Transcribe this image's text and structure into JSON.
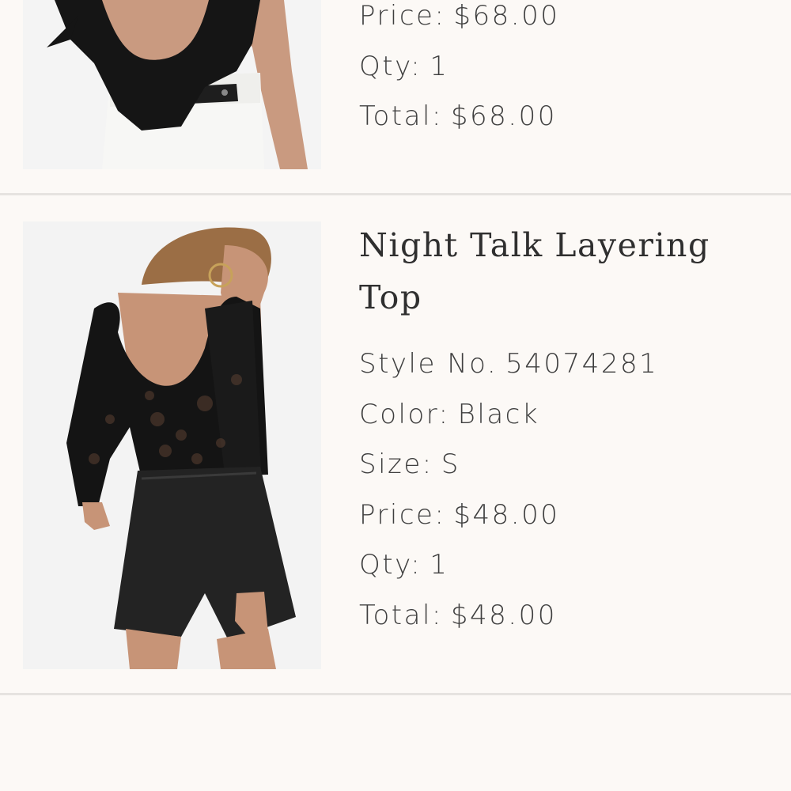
{
  "items": [
    {
      "price_label": "Price:",
      "price": "$68.00",
      "qty_label": "Qty:",
      "qty": "1",
      "total_label": "Total:",
      "total": "$68.00"
    },
    {
      "title_line1": "Night Talk Layering",
      "title_line2": "Top",
      "style_label": "Style No.",
      "style_no": "54074281",
      "color_label": "Color:",
      "color": "Black",
      "size_label": "Size:",
      "size": "S",
      "price_label": "Price:",
      "price": "$48.00",
      "qty_label": "Qty:",
      "qty": "1",
      "total_label": "Total:",
      "total": "$48.00"
    }
  ],
  "colors": {
    "background": "#fcf9f6",
    "divider": "#e6e3e0",
    "text": "#3f3f3f"
  }
}
